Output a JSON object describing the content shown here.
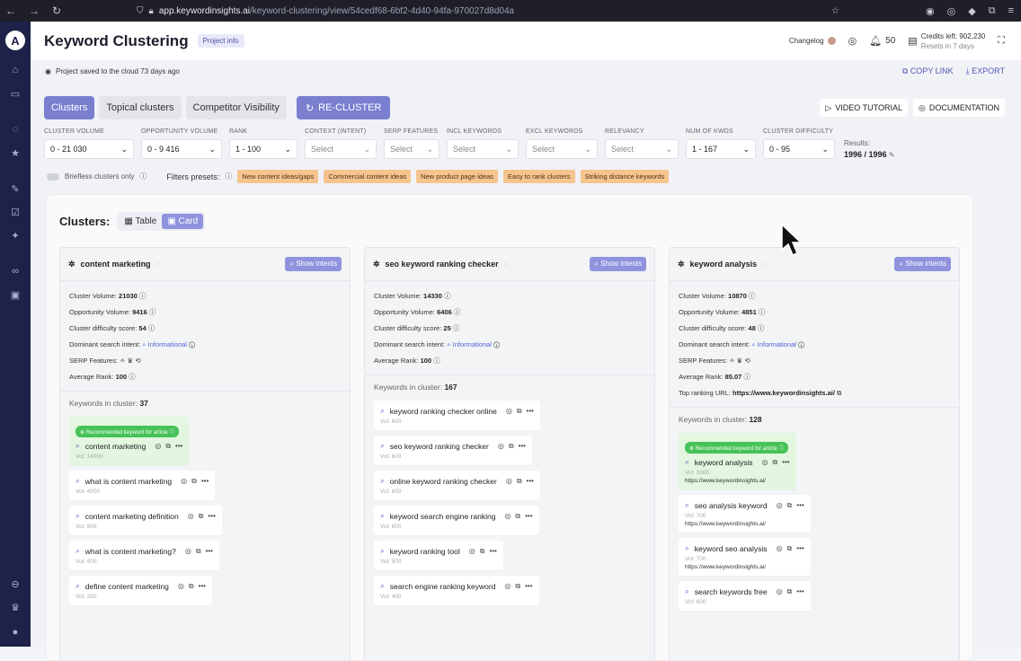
{
  "browser": {
    "url_host": "app.keywordinsights.ai",
    "url_path": "/keyword-clustering/view/54cedf68-6bf2-4d40-94fa-970027d8d04a"
  },
  "header": {
    "title": "Keyword Clustering",
    "project_info": "Project info",
    "changelog": "Changelog",
    "notifications": "50",
    "credits_left": "Credits left: 902,230",
    "resets": "Resets in 7 days"
  },
  "subbar": {
    "saved": "Project saved to the cloud 73 days ago",
    "copy_link": "COPY LINK",
    "export": "EXPORT"
  },
  "tabs": [
    "Clusters",
    "Topical clusters",
    "Competitor Visibility"
  ],
  "recluster": "RE-CLUSTER",
  "video_tutorial": "VIDEO TUTORIAL",
  "documentation": "DOCUMENTATION",
  "filters": [
    {
      "label": "CLUSTER VOLUME",
      "value": "0 - 21 030"
    },
    {
      "label": "OPPORTUNITY VOLUME",
      "value": "0 - 9 416"
    },
    {
      "label": "RANK",
      "value": "1 - 100"
    },
    {
      "label": "CONTEXT (INTENT)",
      "value": "Select"
    },
    {
      "label": "SERP FEATURES",
      "value": "Select"
    },
    {
      "label": "INCL KEYWORDS",
      "value": "Select"
    },
    {
      "label": "EXCL KEYWORDS",
      "value": "Select"
    },
    {
      "label": "RELEVANCY",
      "value": "Select"
    },
    {
      "label": "NUM OF KWDS",
      "value": "1 - 167"
    },
    {
      "label": "CLUSTER DIFFICULTY",
      "value": "0 - 95"
    }
  ],
  "results": {
    "label": "Results:",
    "value": "1996 / 1996"
  },
  "presets": {
    "briefless": "Briefless clusters only",
    "label": "Filters presets:",
    "chips": [
      "New content ideas/gaps",
      "Commercial content ideas",
      "New product page ideas",
      "Easy to rank clusters",
      "Striking distance keywords"
    ]
  },
  "clusters_panel": {
    "title": "Clusters:",
    "view_table": "Table",
    "view_card": "Card"
  },
  "cards": [
    {
      "name": "content marketing",
      "show_intents": "Show intents",
      "volume": "21030",
      "opportunity": "9416",
      "difficulty": "54",
      "intent": "Informational",
      "serp": "SERP Features:",
      "rank": "100",
      "top_url": "",
      "kw_count": "37",
      "keywords": [
        {
          "text": "content marketing",
          "vol": "Vol: 14000",
          "rec": "Recommended keyword for article",
          "url": ""
        },
        {
          "text": "what is content marketing",
          "vol": "Vol: 4000",
          "rec": "",
          "url": ""
        },
        {
          "text": "content marketing definition",
          "vol": "Vol: 900",
          "rec": "",
          "url": ""
        },
        {
          "text": "what is content marketing?",
          "vol": "Vol: 400",
          "rec": "",
          "url": ""
        },
        {
          "text": "define content marketing",
          "vol": "Vol: 350",
          "rec": "",
          "url": ""
        }
      ]
    },
    {
      "name": "seo keyword ranking checker",
      "show_intents": "Show intents",
      "volume": "14330",
      "opportunity": "6406",
      "difficulty": "25",
      "intent": "Informational",
      "serp": "",
      "rank": "100",
      "top_url": "",
      "kw_count": "167",
      "keywords": [
        {
          "text": "keyword ranking checker online",
          "vol": "Vol: 600",
          "rec": "",
          "url": ""
        },
        {
          "text": "seo keyword ranking checker",
          "vol": "Vol: 600",
          "rec": "",
          "url": ""
        },
        {
          "text": "online keyword ranking checker",
          "vol": "Vol: 600",
          "rec": "",
          "url": ""
        },
        {
          "text": "keyword search engine ranking",
          "vol": "Vol: 600",
          "rec": "",
          "url": ""
        },
        {
          "text": "keyword ranking tool",
          "vol": "Vol: 500",
          "rec": "",
          "url": ""
        },
        {
          "text": "search engine ranking keyword",
          "vol": "Vol: 400",
          "rec": "",
          "url": ""
        }
      ]
    },
    {
      "name": "keyword analysis",
      "show_intents": "Show intents",
      "volume": "10870",
      "opportunity": "4851",
      "difficulty": "48",
      "intent": "Informational",
      "serp": "SERP Features:",
      "rank": "85.07",
      "top_url": "https://www.keywordinsights.ai/",
      "kw_count": "128",
      "keywords": [
        {
          "text": "keyword analysis",
          "vol": "Vol: 1000",
          "rec": "Recommended keyword for article",
          "url": "https://www.keywordinsights.ai/"
        },
        {
          "text": "seo analysis keyword",
          "vol": "Vol: 700",
          "rec": "",
          "url": "https://www.keywordinsights.ai/"
        },
        {
          "text": "keyword seo analysis",
          "vol": "Vol: 700",
          "rec": "",
          "url": "https://www.keywordinsights.ai/"
        },
        {
          "text": "search keywords free",
          "vol": "Vol: 600",
          "rec": "",
          "url": ""
        }
      ]
    }
  ],
  "labels": {
    "cluster_volume": "Cluster Volume:",
    "opportunity_volume": "Opportunity Volume:",
    "difficulty": "Cluster difficulty score:",
    "intent": "Dominant search intent:",
    "avg_rank": "Average Rank:",
    "top_url": "Top ranking URL:",
    "kw_in_cluster": "Keywords in cluster:"
  }
}
